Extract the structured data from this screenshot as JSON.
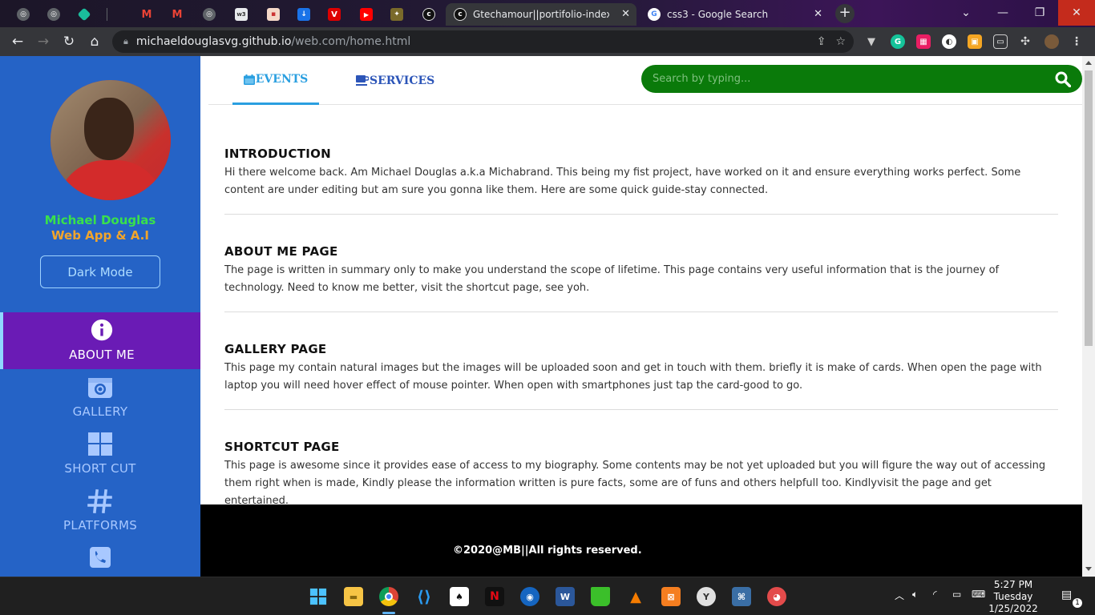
{
  "browser": {
    "tabs": [
      {
        "title": "Gtechamour||portifolio-index-pa",
        "active": true
      },
      {
        "title": "css3 - Google Search",
        "active": false
      }
    ],
    "url_host": "michaeldouglasvg.github.io",
    "url_path": "/web.com/home.html"
  },
  "sidebar": {
    "name": "Michael Douglas",
    "role": "Web App & A.I",
    "dark_mode_label": "Dark Mode",
    "items": [
      {
        "label": "ABOUT ME",
        "icon": "info-icon",
        "active": true
      },
      {
        "label": "GALLERY",
        "icon": "camera-icon",
        "active": false
      },
      {
        "label": "SHORT CUT",
        "icon": "grid-icon",
        "active": false
      },
      {
        "label": "PLATFORMS",
        "icon": "hashtag-icon",
        "active": false
      },
      {
        "label": "",
        "icon": "phone-icon",
        "active": false
      }
    ]
  },
  "topnav": {
    "tabs": [
      {
        "label": "EVENTS",
        "icon": "calendar-icon",
        "active": true
      },
      {
        "label": "SERVICES",
        "icon": "coffee-icon",
        "active": false
      }
    ],
    "search_placeholder": "Search by typing..."
  },
  "sections": [
    {
      "title": "INTRODUCTION",
      "body": "Hi there welcome back. Am Michael Douglas a.k.a Michabrand. This being my fist project, have worked on it and ensure everything works perfect. Some content are under editing but am sure you gonna like them. Here are some quick guide-stay connected."
    },
    {
      "title": "ABOUT ME PAGE",
      "body": "The page is written in summary only to make you understand the scope of lifetime. This page contains very useful information that is the journey of technology. Need to know me better, visit the shortcut page, see yoh."
    },
    {
      "title": "GALLERY PAGE",
      "body": "This page my contain natural images but the images will be uploaded soon and get in touch with them. briefly it is make of cards. When open the page with laptop you will need hover effect of mouse pointer. When open with smartphones just tap the card-good to go."
    },
    {
      "title": "SHORTCUT PAGE",
      "body": "This page is awesome since it provides ease of access to my biography. Some contents may be not yet uploaded but you will figure the way out of accessing them right when is made, Kindly please the information written is pure facts, some are of funs and others helpfull too. Kindlyvisit the page and get entertained."
    }
  ],
  "footer": {
    "text": "©2020@MB||All rights reserved."
  },
  "taskbar": {
    "time": "5:27 PM",
    "day": "Tuesday",
    "date": "1/25/2022",
    "notification_count": "1"
  },
  "colors": {
    "sidebar": "#2563c6",
    "active_item": "#6a1bb5",
    "search_bg": "#0a7a0a",
    "name_color": "#39e14b",
    "role_color": "#f2a52b"
  }
}
